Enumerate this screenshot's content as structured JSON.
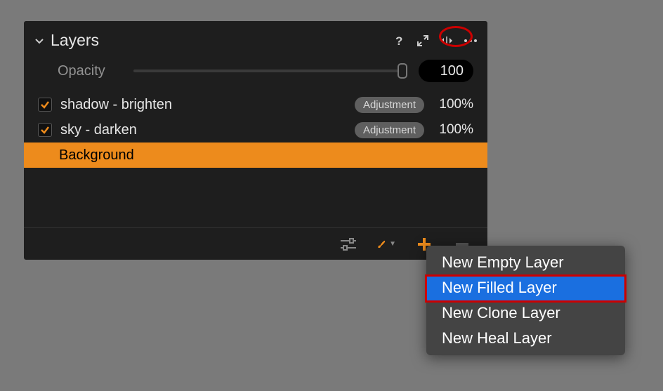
{
  "panel": {
    "title": "Layers",
    "opacity_label": "Opacity",
    "opacity_value": "100"
  },
  "layers": [
    {
      "name": "shadow - brighten",
      "badge": "Adjustment",
      "opacity": "100%",
      "checked": true,
      "selected": false
    },
    {
      "name": "sky - darken",
      "badge": "Adjustment",
      "opacity": "100%",
      "checked": true,
      "selected": false
    },
    {
      "name": "Background",
      "badge": null,
      "opacity": null,
      "checked": null,
      "selected": true
    }
  ],
  "menu": {
    "items": [
      {
        "label": "New Empty Layer",
        "highlighted": false
      },
      {
        "label": "New Filled Layer",
        "highlighted": true
      },
      {
        "label": "New Clone Layer",
        "highlighted": false
      },
      {
        "label": "New Heal Layer",
        "highlighted": false
      }
    ]
  }
}
